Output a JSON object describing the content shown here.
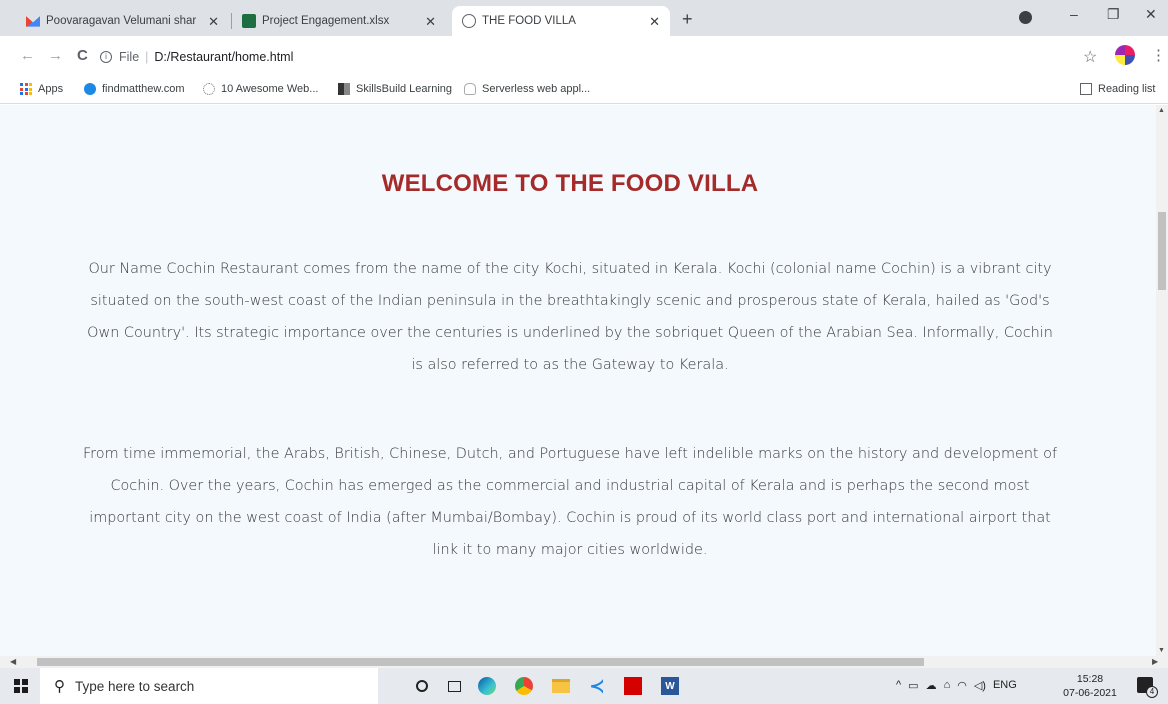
{
  "browser": {
    "tabs": [
      {
        "title": "Poovaragavan Velumani shared",
        "icon": "gmail-icon",
        "close": "✕"
      },
      {
        "title": "Project Engagement.xlsx",
        "icon": "excel-icon",
        "close": "✕"
      },
      {
        "title": "THE FOOD VILLA",
        "icon": "globe-icon",
        "close": "✕"
      }
    ],
    "new_tab": "+",
    "window_controls": {
      "minimize": "–",
      "restore": "❐",
      "close": "✕"
    },
    "address": {
      "scheme": "File",
      "path": "D:/Restaurant/home.html"
    },
    "nav": {
      "back": "←",
      "forward": "→",
      "reload": "C"
    },
    "bookmarks": [
      {
        "label": "Apps",
        "icon": "apps-grid-icon"
      },
      {
        "label": "findmatthew.com",
        "icon": "findmatthew-icon"
      },
      {
        "label": "10 Awesome Web...",
        "icon": "web-icon"
      },
      {
        "label": "SkillsBuild Learning",
        "icon": "skillsbuild-icon"
      },
      {
        "label": "Serverless web appl...",
        "icon": "serverless-icon"
      }
    ],
    "reading_list": "Reading list"
  },
  "page": {
    "heading": "WELCOME TO THE FOOD VILLA",
    "paragraphs": [
      "Our Name Cochin Restaurant comes from the name of the city Kochi, situated in Kerala. Kochi (colonial name Cochin) is a vibrant city situated on the south-west coast of the Indian peninsula in the breathtakingly scenic and prosperous state of Kerala, hailed as 'God's Own Country'. Its strategic importance over the centuries is underlined by the sobriquet Queen of the Arabian Sea. Informally, Cochin is also referred to as the Gateway to Kerala.",
      "From time immemorial, the Arabs, British, Chinese, Dutch, and Portuguese have left indelible marks on the history and development of Cochin. Over the years, Cochin has emerged as the commercial and industrial capital of Kerala and is perhaps the second most important city on the west coast of India (after Mumbai/Bombay). Cochin is proud of its world class port and international airport that link it to many major cities worldwide."
    ],
    "colors": {
      "heading": "#a52a2a",
      "background": "#f3f9fc"
    }
  },
  "taskbar": {
    "search_placeholder": "Type here to search",
    "tray_language": "ENG",
    "time": "15:28",
    "date": "07-06-2021",
    "notification_count": "4"
  }
}
